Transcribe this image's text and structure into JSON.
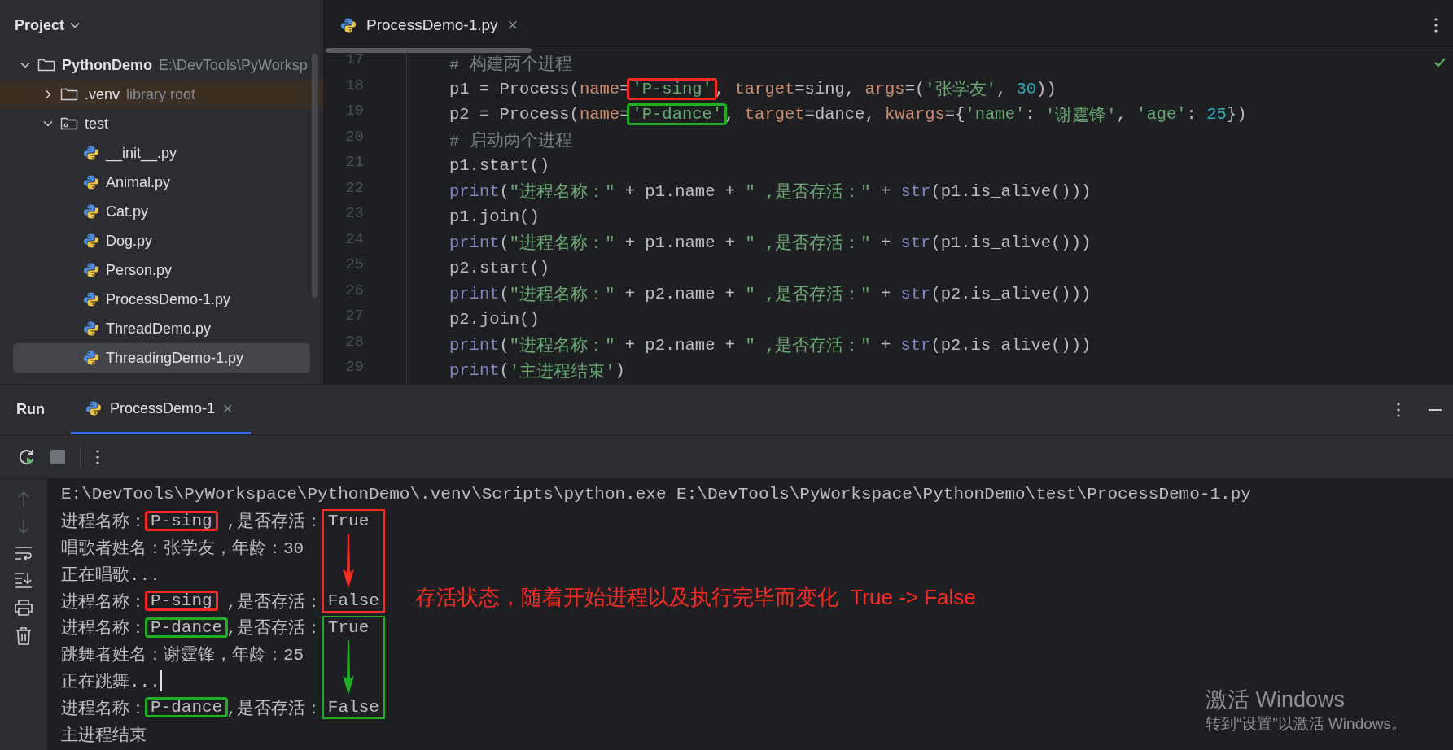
{
  "project_panel": {
    "title": "Project",
    "tree": [
      {
        "label": "PythonDemo",
        "hint": "E:\\DevTools\\PyWorksp",
        "kind": "folder",
        "expanded": true,
        "selected": false,
        "children": [
          {
            "label": ".venv",
            "hint": "library root",
            "kind": "library",
            "expanded": false,
            "selected": false
          },
          {
            "label": "test",
            "kind": "package",
            "expanded": true,
            "selected": false,
            "children": [
              {
                "label": "__init__.py",
                "kind": "python",
                "selected": false
              },
              {
                "label": "Animal.py",
                "kind": "python",
                "selected": false
              },
              {
                "label": "Cat.py",
                "kind": "python",
                "selected": false
              },
              {
                "label": "Dog.py",
                "kind": "python",
                "selected": false
              },
              {
                "label": "Person.py",
                "kind": "python",
                "selected": false
              },
              {
                "label": "ProcessDemo-1.py",
                "kind": "python",
                "selected": false
              },
              {
                "label": "ThreadDemo.py",
                "kind": "python",
                "selected": false
              },
              {
                "label": "ThreadingDemo-1.py",
                "kind": "python",
                "selected": true
              }
            ]
          }
        ]
      }
    ]
  },
  "editor": {
    "tabs": [
      {
        "label": "ProcessDemo-1.py",
        "close": "×",
        "selected": true
      }
    ],
    "lines": [
      {
        "number": "17",
        "tokens": [
          {
            "kind": "comment",
            "text": "# 构建两个进程"
          }
        ]
      },
      {
        "number": "18",
        "tokens": [
          {
            "kind": "plain",
            "text": "p1 = Process("
          },
          {
            "kind": "param",
            "text": "name"
          },
          {
            "kind": "plain",
            "text": "="
          },
          {
            "kind": "string",
            "text": "'P-sing'",
            "color": "#ff2a1f"
          },
          {
            "kind": "plain",
            "text": ", "
          },
          {
            "kind": "param",
            "text": "target"
          },
          {
            "kind": "plain",
            "text": "=sing, "
          },
          {
            "kind": "param",
            "text": "args"
          },
          {
            "kind": "plain",
            "text": "=("
          },
          {
            "kind": "string",
            "text": "'张学友'"
          },
          {
            "kind": "plain",
            "text": ", "
          },
          {
            "kind": "number",
            "text": "30"
          },
          {
            "kind": "plain",
            "text": "))"
          }
        ]
      },
      {
        "number": "19",
        "tokens": [
          {
            "kind": "plain",
            "text": "p2 = Process("
          },
          {
            "kind": "param",
            "text": "name"
          },
          {
            "kind": "plain",
            "text": "="
          },
          {
            "kind": "string",
            "text": "'P-dance'",
            "color": "#1fb01f"
          },
          {
            "kind": "plain",
            "text": ", "
          },
          {
            "kind": "param",
            "text": "target"
          },
          {
            "kind": "plain",
            "text": "=dance, "
          },
          {
            "kind": "param",
            "text": "kwargs"
          },
          {
            "kind": "plain",
            "text": "={"
          },
          {
            "kind": "string",
            "text": "'name'"
          },
          {
            "kind": "plain",
            "text": ": "
          },
          {
            "kind": "string",
            "text": "'谢霆锋'"
          },
          {
            "kind": "plain",
            "text": ", "
          },
          {
            "kind": "string",
            "text": "'age'"
          },
          {
            "kind": "plain",
            "text": ": "
          },
          {
            "kind": "number",
            "text": "25"
          },
          {
            "kind": "plain",
            "text": "})"
          }
        ]
      },
      {
        "number": "20",
        "tokens": [
          {
            "kind": "comment",
            "text": "# 启动两个进程"
          }
        ]
      },
      {
        "number": "21",
        "tokens": [
          {
            "kind": "plain",
            "text": "p1.start()"
          }
        ]
      },
      {
        "number": "22",
        "tokens": [
          {
            "kind": "builtin",
            "text": "print"
          },
          {
            "kind": "plain",
            "text": "("
          },
          {
            "kind": "string",
            "text": "\"进程名称：\""
          },
          {
            "kind": "plain",
            "text": " + p1.name + "
          },
          {
            "kind": "string",
            "text": "\" ,是否存活：\""
          },
          {
            "kind": "plain",
            "text": " + "
          },
          {
            "kind": "builtin",
            "text": "str"
          },
          {
            "kind": "plain",
            "text": "(p1.is_alive()))"
          }
        ]
      },
      {
        "number": "23",
        "tokens": [
          {
            "kind": "plain",
            "text": "p1.join()"
          }
        ]
      },
      {
        "number": "24",
        "tokens": [
          {
            "kind": "builtin",
            "text": "print"
          },
          {
            "kind": "plain",
            "text": "("
          },
          {
            "kind": "string",
            "text": "\"进程名称：\""
          },
          {
            "kind": "plain",
            "text": " + p1.name + "
          },
          {
            "kind": "string",
            "text": "\" ,是否存活：\""
          },
          {
            "kind": "plain",
            "text": " + "
          },
          {
            "kind": "builtin",
            "text": "str"
          },
          {
            "kind": "plain",
            "text": "(p1.is_alive()))"
          }
        ]
      },
      {
        "number": "25",
        "tokens": [
          {
            "kind": "plain",
            "text": "p2.start()"
          }
        ]
      },
      {
        "number": "26",
        "tokens": [
          {
            "kind": "builtin",
            "text": "print"
          },
          {
            "kind": "plain",
            "text": "("
          },
          {
            "kind": "string",
            "text": "\"进程名称：\""
          },
          {
            "kind": "plain",
            "text": " + p2.name + "
          },
          {
            "kind": "string",
            "text": "\" ,是否存活：\""
          },
          {
            "kind": "plain",
            "text": " + "
          },
          {
            "kind": "builtin",
            "text": "str"
          },
          {
            "kind": "plain",
            "text": "(p2.is_alive()))"
          }
        ]
      },
      {
        "number": "27",
        "tokens": [
          {
            "kind": "plain",
            "text": "p2.join()"
          }
        ]
      },
      {
        "number": "28",
        "tokens": [
          {
            "kind": "builtin",
            "text": "print"
          },
          {
            "kind": "plain",
            "text": "("
          },
          {
            "kind": "string",
            "text": "\"进程名称：\""
          },
          {
            "kind": "plain",
            "text": " + p2.name + "
          },
          {
            "kind": "string",
            "text": "\" ,是否存活：\""
          },
          {
            "kind": "plain",
            "text": " + "
          },
          {
            "kind": "builtin",
            "text": "str"
          },
          {
            "kind": "plain",
            "text": "(p2.is_alive()))"
          }
        ]
      },
      {
        "number": "29",
        "tokens": [
          {
            "kind": "builtin",
            "text": "print"
          },
          {
            "kind": "plain",
            "text": "("
          },
          {
            "kind": "string",
            "text": "'主进程结束'"
          },
          {
            "kind": "plain",
            "text": ")"
          }
        ]
      }
    ]
  },
  "run_panel": {
    "title": "Run",
    "tabs": [
      {
        "label": "ProcessDemo-1",
        "close": "×",
        "selected": true
      }
    ],
    "console": {
      "lines": [
        {
          "caret": false,
          "tokens": [
            {
              "kind": "plain",
              "text": "E:\\DevTools\\PyWorkspace\\PythonDemo\\.venv\\Scripts\\python.exe E:\\DevTools\\PyWorkspace\\PythonDemo\\test\\ProcessDemo-1.py"
            }
          ]
        },
        {
          "caret": false,
          "tokens": [
            {
              "kind": "plain",
              "text": "进程名称："
            },
            {
              "kind": "highlight",
              "text": "P-sing",
              "color": "#ff2a1f"
            },
            {
              "kind": "plain",
              "text": " ,是否存活："
            },
            {
              "kind": "callout-start",
              "text": "True"
            }
          ]
        },
        {
          "caret": false,
          "tokens": [
            {
              "kind": "plain",
              "text": "唱歌者姓名：张学友，年龄：30"
            }
          ]
        },
        {
          "caret": false,
          "tokens": [
            {
              "kind": "plain",
              "text": "正在唱歌..."
            }
          ]
        },
        {
          "caret": false,
          "tokens": [
            {
              "kind": "plain",
              "text": "进程名称："
            },
            {
              "kind": "highlight",
              "text": "P-sing",
              "color": "#ff2a1f"
            },
            {
              "kind": "plain",
              "text": " ,是否存活："
            },
            {
              "kind": "callout-end",
              "text": "False"
            }
          ]
        },
        {
          "caret": false,
          "tokens": [
            {
              "kind": "plain",
              "text": "进程名称："
            },
            {
              "kind": "highlight",
              "text": "P-dance",
              "color": "#1fb01f"
            },
            {
              "kind": "plain",
              "text": ",是否存活："
            },
            {
              "kind": "callout-start",
              "text": "True"
            }
          ]
        },
        {
          "caret": false,
          "tokens": [
            {
              "kind": "plain",
              "text": "跳舞者姓名：谢霆锋，年龄：25"
            }
          ]
        },
        {
          "caret": true,
          "tokens": [
            {
              "kind": "plain",
              "text": "正在跳舞..."
            }
          ]
        },
        {
          "caret": false,
          "tokens": [
            {
              "kind": "plain",
              "text": "进程名称："
            },
            {
              "kind": "highlight",
              "text": "P-dance",
              "color": "#1fb01f"
            },
            {
              "kind": "plain",
              "text": ",是否存活："
            },
            {
              "kind": "callout-end",
              "text": "False"
            }
          ]
        },
        {
          "caret": false,
          "tokens": [
            {
              "kind": "plain",
              "text": "主进程结束"
            }
          ]
        }
      ],
      "callouts": [
        {
          "color": "#ff2a1f"
        },
        {
          "color": "#1fb01f"
        }
      ],
      "note": "存活状态，随着开始进程以及执行完毕而变化  True -> False"
    }
  },
  "os_notice": {
    "title": "激活 Windows",
    "text": "转到“设置”以激活 Windows。"
  }
}
